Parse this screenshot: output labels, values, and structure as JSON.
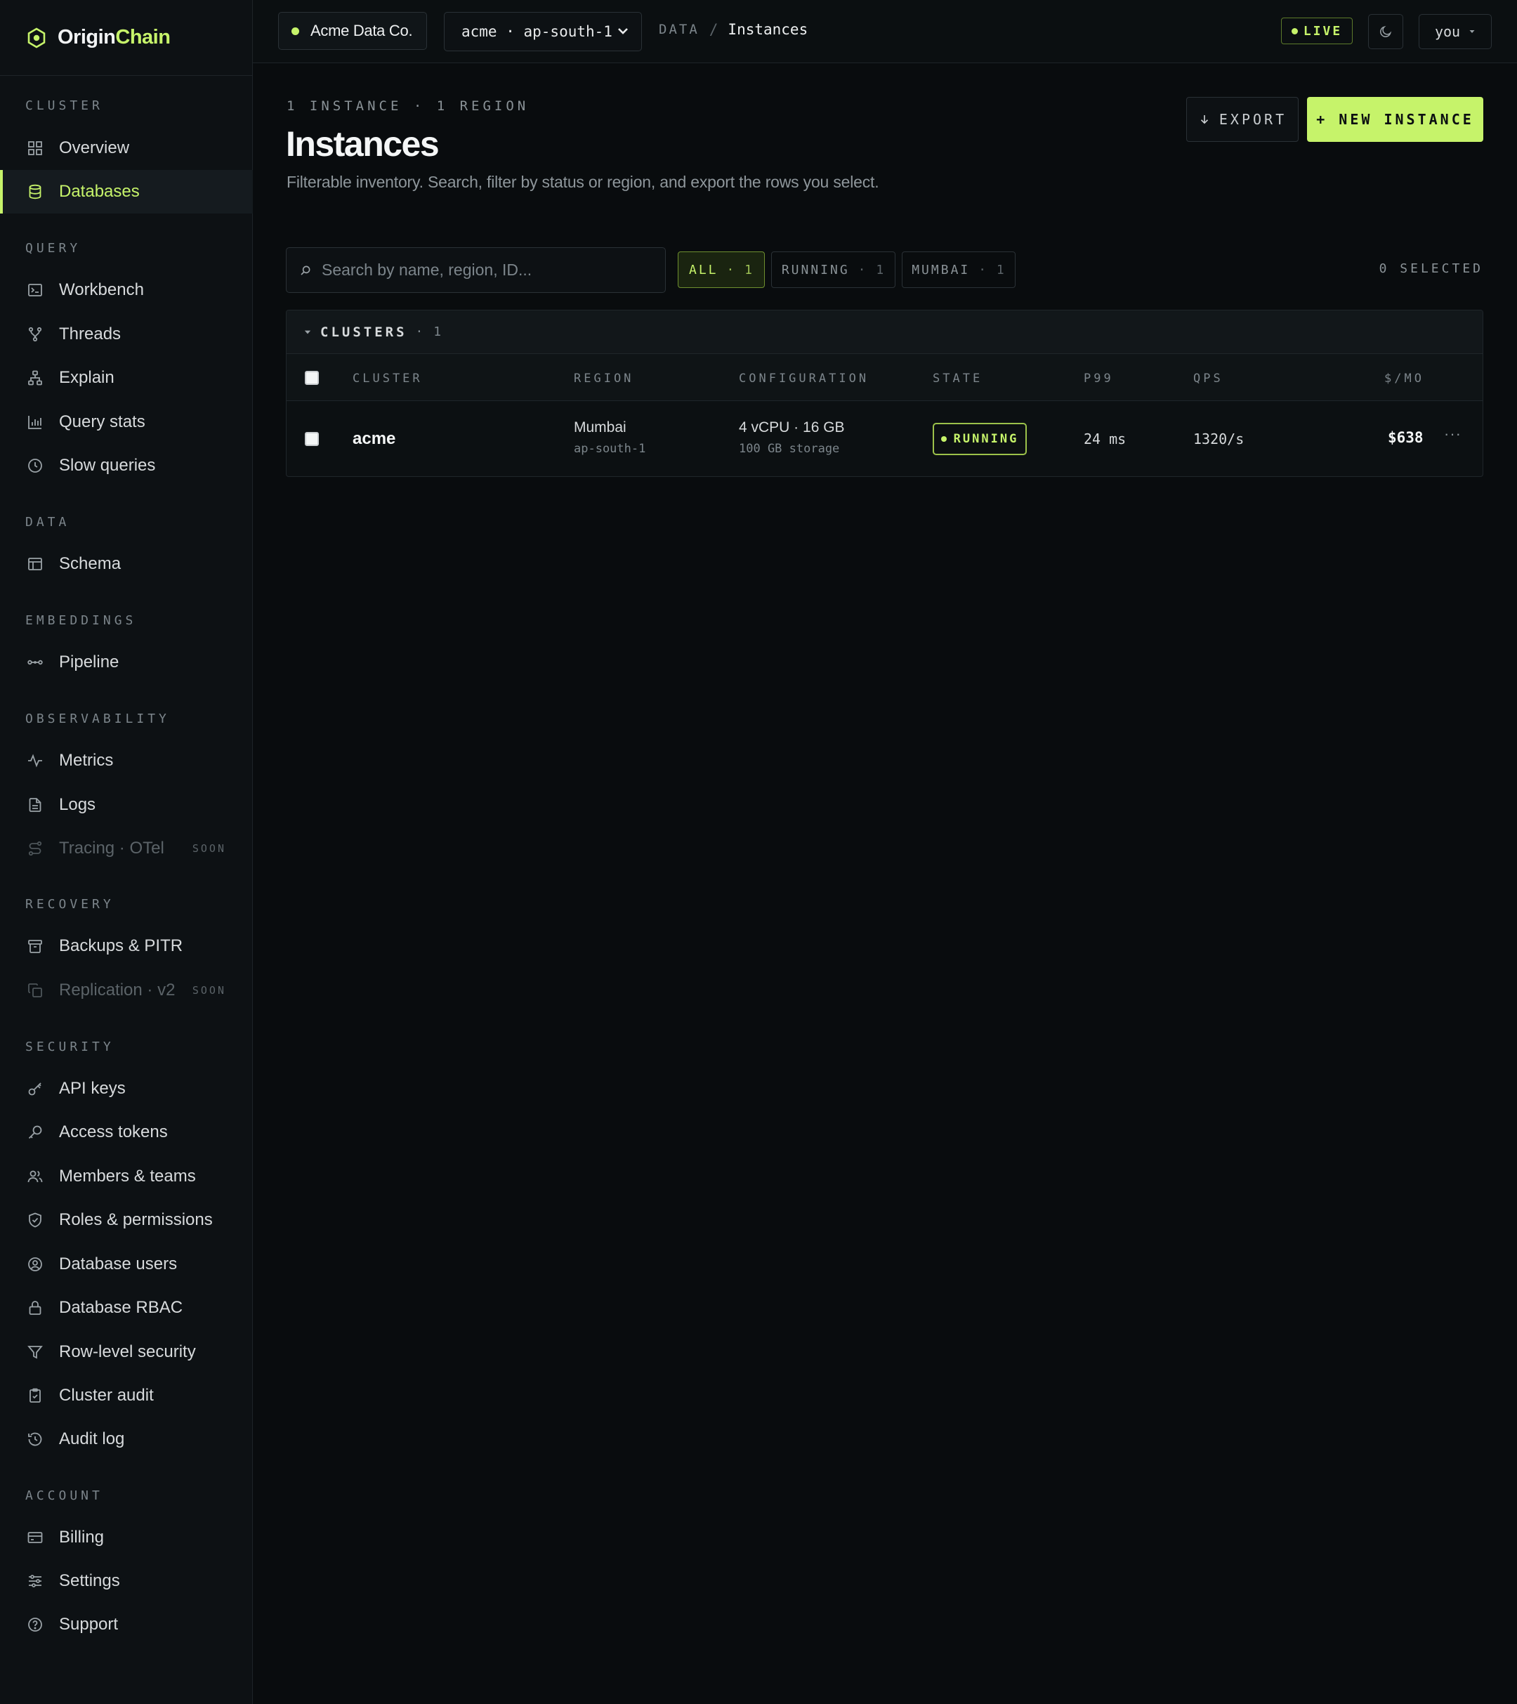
{
  "brand": {
    "name_a": "Origin",
    "name_b": "Chain"
  },
  "sidebar": {
    "sections": [
      {
        "heading": "CLUSTER",
        "items": [
          {
            "label": "Overview",
            "icon": "grid-icon"
          },
          {
            "label": "Databases",
            "icon": "database-icon",
            "active": true
          }
        ]
      },
      {
        "heading": "QUERY",
        "items": [
          {
            "label": "Workbench",
            "icon": "terminal-icon"
          },
          {
            "label": "Threads",
            "icon": "branch-icon"
          },
          {
            "label": "Explain",
            "icon": "tree-icon"
          },
          {
            "label": "Query stats",
            "icon": "bar-chart-icon"
          },
          {
            "label": "Slow queries",
            "icon": "clock-icon"
          }
        ]
      },
      {
        "heading": "DATA",
        "items": [
          {
            "label": "Schema",
            "icon": "table-icon"
          }
        ]
      },
      {
        "heading": "EMBEDDINGS",
        "items": [
          {
            "label": "Pipeline",
            "icon": "pipeline-icon"
          }
        ]
      },
      {
        "heading": "OBSERVABILITY",
        "items": [
          {
            "label": "Metrics",
            "icon": "pulse-icon"
          },
          {
            "label": "Logs",
            "icon": "file-icon"
          },
          {
            "label": "Tracing · OTel",
            "icon": "route-icon",
            "disabled": true,
            "badge": "SOON"
          }
        ]
      },
      {
        "heading": "RECOVERY",
        "items": [
          {
            "label": "Backups & PITR",
            "icon": "archive-icon"
          },
          {
            "label": "Replication · v2",
            "icon": "copy-icon",
            "disabled": true,
            "badge": "SOON"
          }
        ]
      },
      {
        "heading": "SECURITY",
        "items": [
          {
            "label": "API keys",
            "icon": "key-icon"
          },
          {
            "label": "Access tokens",
            "icon": "token-icon"
          },
          {
            "label": "Members & teams",
            "icon": "users-icon"
          },
          {
            "label": "Roles & permissions",
            "icon": "shield-icon"
          },
          {
            "label": "Database users",
            "icon": "user-circle-icon"
          },
          {
            "label": "Database RBAC",
            "icon": "lock-icon"
          },
          {
            "label": "Row-level security",
            "icon": "filter-icon"
          },
          {
            "label": "Cluster audit",
            "icon": "clipboard-icon"
          },
          {
            "label": "Audit log",
            "icon": "history-icon"
          }
        ]
      },
      {
        "heading": "ACCOUNT",
        "items": [
          {
            "label": "Billing",
            "icon": "card-icon"
          },
          {
            "label": "Settings",
            "icon": "sliders-icon"
          },
          {
            "label": "Support",
            "icon": "help-icon"
          }
        ]
      }
    ]
  },
  "topbar": {
    "org": "Acme Data Co.",
    "cluster": "acme · ap-south-1",
    "breadcrumb_section": "DATA",
    "breadcrumb_sep": "/",
    "breadcrumb_page": "Instances",
    "live": "LIVE",
    "user": "you"
  },
  "page": {
    "kicker": "1 INSTANCE · 1 REGION",
    "title": "Instances",
    "description": "Filterable inventory. Search, filter by status or region, and export the rows you select.",
    "export_label": "EXPORT",
    "new_label": "+ NEW INSTANCE"
  },
  "filters": {
    "search_placeholder": "Search by name, region, ID...",
    "chips": [
      {
        "label": "ALL",
        "count": "· 1",
        "active": true
      },
      {
        "label": "RUNNING",
        "count": "· 1"
      },
      {
        "label": "MUMBAI",
        "count": "· 1"
      }
    ],
    "selected": "0 SELECTED"
  },
  "table": {
    "group_title": "CLUSTERS",
    "group_count": "· 1",
    "columns": [
      "CLUSTER",
      "REGION",
      "CONFIGURATION",
      "STATE",
      "P99",
      "QPS",
      "$/MO"
    ],
    "rows": [
      {
        "name": "acme",
        "region": "Mumbai",
        "region_code": "ap-south-1",
        "config": "4 vCPU · 16 GB",
        "storage": "100 GB storage",
        "state": "RUNNING",
        "p99": "24 ms",
        "qps": "1320/s",
        "cost": "$638",
        "more": "···"
      }
    ]
  },
  "colors": {
    "accent": "#c6f36a",
    "background": "#090c0e",
    "sidebar": "#0d1114"
  }
}
